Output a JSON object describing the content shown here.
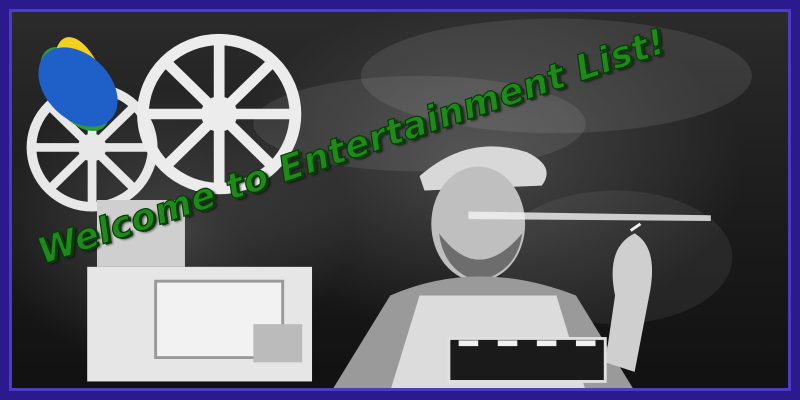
{
  "banner": {
    "headline": "Welcome to Entertainment List!",
    "logo_icon": "circular-swoosh-logo-icon",
    "photo_description_icon": "film-projector-and-smoking-man-photo",
    "colors": {
      "frame": "#2a1a8e",
      "headline_green": "#1f8a1a",
      "logo_blue": "#1f5fc8",
      "logo_yellow": "#f2d21b",
      "logo_green": "#2f9a3a"
    }
  }
}
